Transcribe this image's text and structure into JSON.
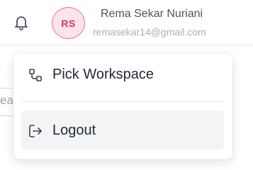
{
  "header": {
    "notification_icon": "bell-icon",
    "avatar_initials": "RS",
    "user_name": "Rema Sekar Nuriani",
    "user_email": "remasekar14@gmail.com"
  },
  "background": {
    "search_fragment_text": "ea"
  },
  "menu": {
    "items": [
      {
        "label": "Pick Workspace",
        "icon": "workspace-switch-icon"
      },
      {
        "label": "Logout",
        "icon": "logout-icon"
      }
    ]
  },
  "colors": {
    "avatar_bg": "#fde4ec",
    "avatar_border": "#f06a98",
    "avatar_text": "#d6336c",
    "hover_bg": "#f3f4f6"
  }
}
